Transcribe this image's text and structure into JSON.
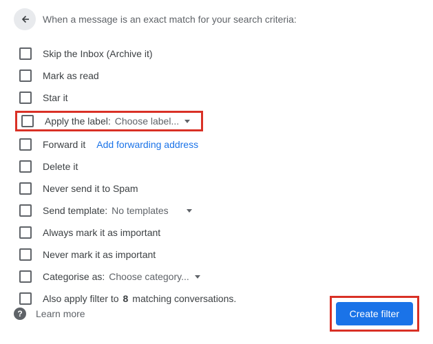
{
  "header": {
    "text": "When a message is an exact match for your search criteria:"
  },
  "options": {
    "skip_inbox": "Skip the Inbox (Archive it)",
    "mark_read": "Mark as read",
    "star_it": "Star it",
    "apply_label": "Apply the label:",
    "apply_label_dropdown": "Choose label...",
    "forward_it": "Forward it",
    "forward_link": "Add forwarding address",
    "delete_it": "Delete it",
    "never_spam": "Never send it to Spam",
    "send_template": "Send template:",
    "send_template_dropdown": "No templates",
    "always_important": "Always mark it as important",
    "never_important": "Never mark it as important",
    "categorise": "Categorise as:",
    "categorise_dropdown": "Choose category...",
    "also_apply_pre": "Also apply filter to ",
    "also_apply_count": "8",
    "also_apply_post": " matching conversations."
  },
  "footer": {
    "learn_more": "Learn more",
    "create_filter": "Create filter"
  }
}
